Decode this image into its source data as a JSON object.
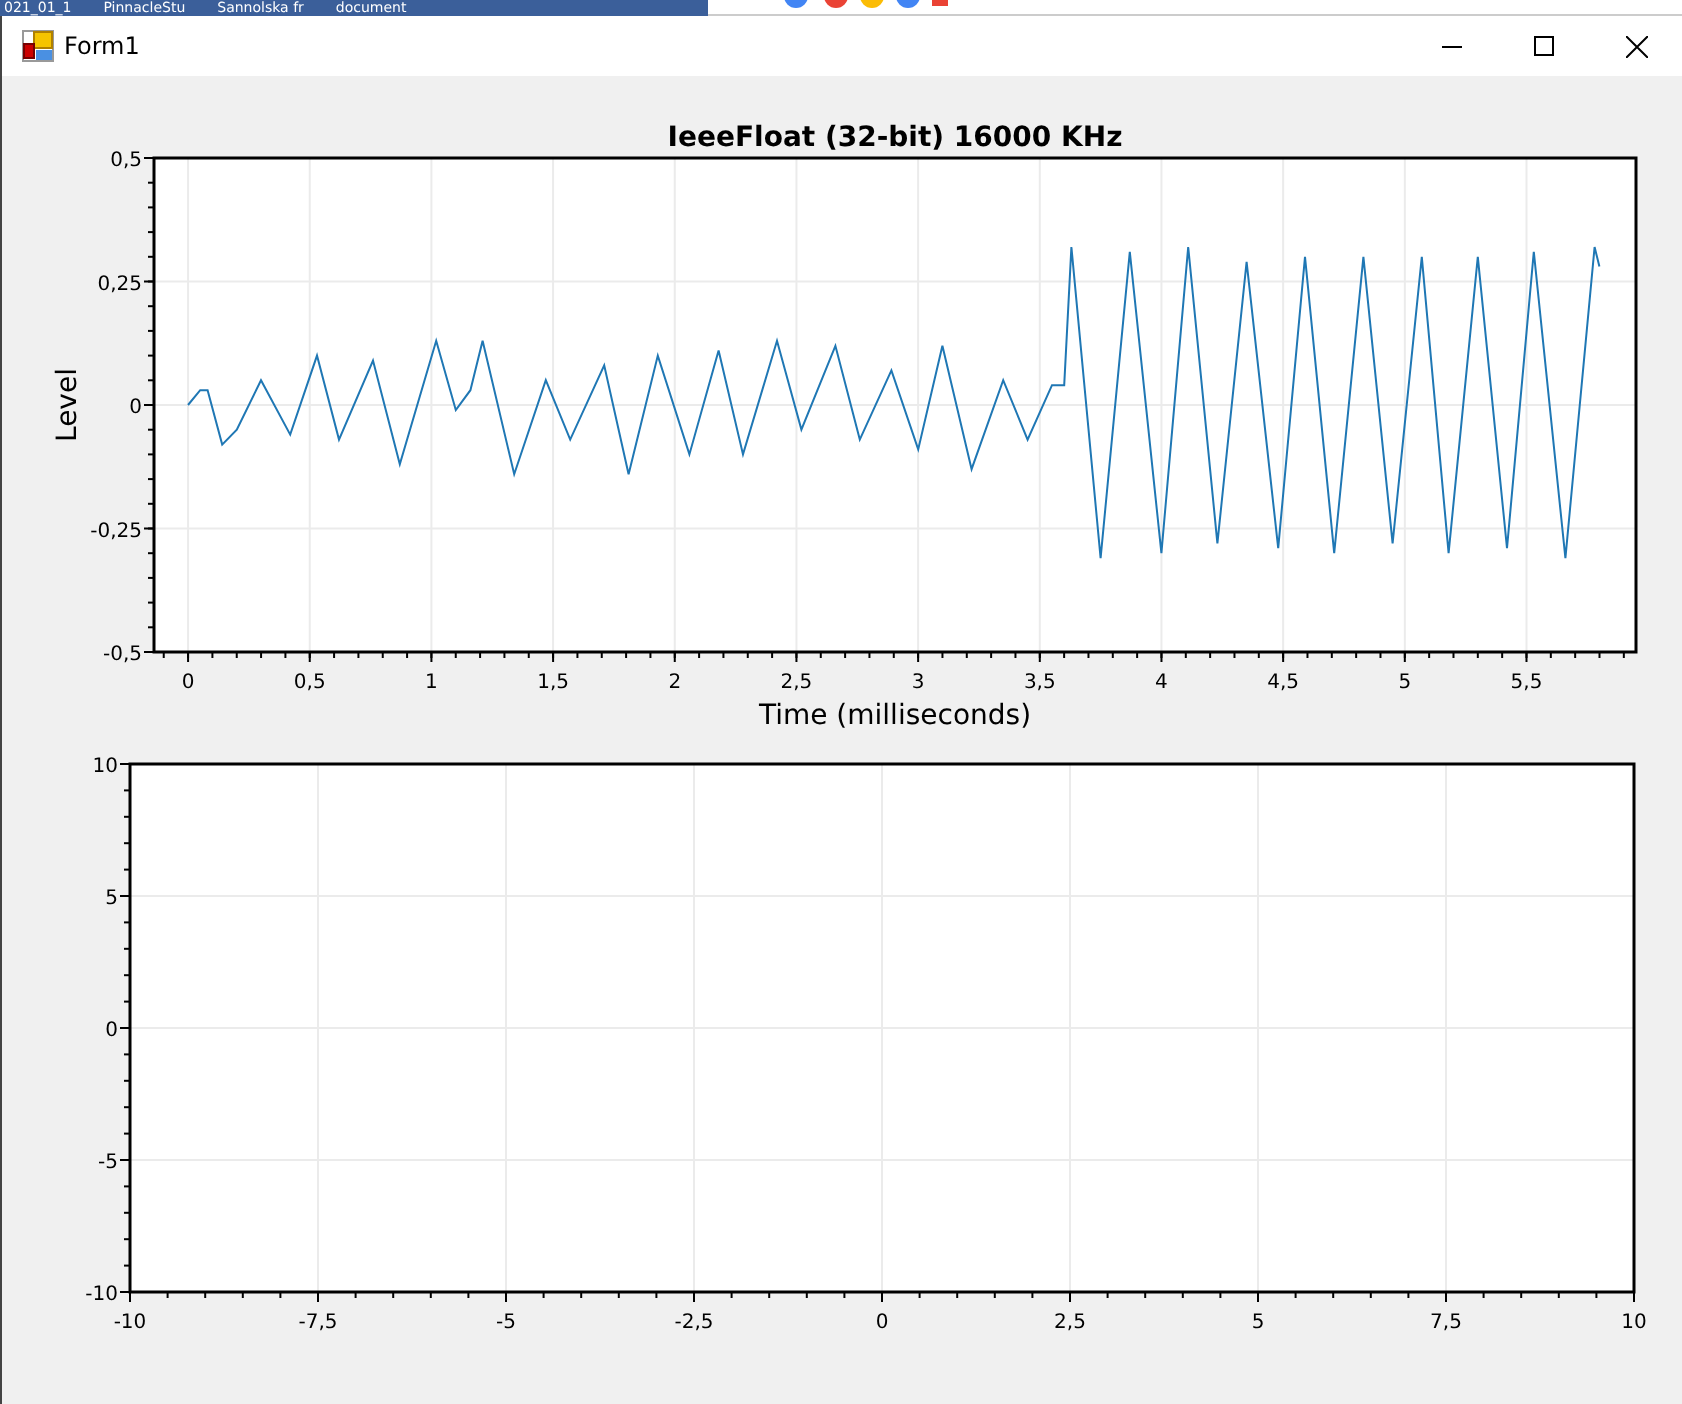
{
  "desktop": {
    "labels": [
      "021_01_1",
      "PinnacleStu",
      "Sannolska fr",
      "document"
    ]
  },
  "window": {
    "title": "Form1"
  },
  "charts": [
    {
      "chart_data": {
        "type": "line",
        "grid": true,
        "title": "IeeeFloat (32-bit) 16000 KHz",
        "xlabel": "Time (milliseconds)",
        "ylabel": "Level",
        "xlim": [
          -0.14,
          5.95
        ],
        "ylim": [
          -0.5,
          0.5
        ],
        "xticks": [
          {
            "value": 0,
            "label": "0"
          },
          {
            "value": 0.5,
            "label": "0,5"
          },
          {
            "value": 1,
            "label": "1"
          },
          {
            "value": 1.5,
            "label": "1,5"
          },
          {
            "value": 2,
            "label": "2"
          },
          {
            "value": 2.5,
            "label": "2,5"
          },
          {
            "value": 3,
            "label": "3"
          },
          {
            "value": 3.5,
            "label": "3,5"
          },
          {
            "value": 4,
            "label": "4"
          },
          {
            "value": 4.5,
            "label": "4,5"
          },
          {
            "value": 5,
            "label": "5"
          },
          {
            "value": 5.5,
            "label": "5,5"
          }
        ],
        "yticks": [
          {
            "value": -0.5,
            "label": "-0,5"
          },
          {
            "value": -0.25,
            "label": "-0,25"
          },
          {
            "value": 0,
            "label": "0"
          },
          {
            "value": 0.25,
            "label": "0,25"
          },
          {
            "value": 0.5,
            "label": "0,5"
          }
        ],
        "x": [
          0,
          0.05,
          0.08,
          0.14,
          0.2,
          0.3,
          0.42,
          0.53,
          0.62,
          0.76,
          0.87,
          1.02,
          1.1,
          1.16,
          1.21,
          1.34,
          1.47,
          1.57,
          1.71,
          1.81,
          1.93,
          2.06,
          2.18,
          2.28,
          2.42,
          2.52,
          2.66,
          2.76,
          2.89,
          3.0,
          3.1,
          3.22,
          3.35,
          3.45,
          3.55,
          3.6,
          3.63,
          3.75,
          3.87,
          4.0,
          4.11,
          4.23,
          4.35,
          4.48,
          4.59,
          4.71,
          4.83,
          4.95,
          5.07,
          5.18,
          5.3,
          5.42,
          5.53,
          5.66,
          5.78,
          5.8
        ],
        "series": [
          {
            "color": "#1f77b4",
            "values": [
              0,
              0.03,
              0.03,
              -0.08,
              -0.05,
              0.05,
              -0.06,
              0.1,
              -0.07,
              0.09,
              -0.12,
              0.13,
              -0.01,
              0.03,
              0.13,
              -0.14,
              0.05,
              -0.07,
              0.08,
              -0.14,
              0.1,
              -0.1,
              0.11,
              -0.1,
              0.13,
              -0.05,
              0.12,
              -0.07,
              0.07,
              -0.09,
              0.12,
              -0.13,
              0.05,
              -0.07,
              0.04,
              0.04,
              0.32,
              -0.31,
              0.31,
              -0.3,
              0.32,
              -0.28,
              0.29,
              -0.29,
              0.3,
              -0.3,
              0.3,
              -0.28,
              0.3,
              -0.3,
              0.3,
              -0.29,
              0.31,
              -0.31,
              0.32,
              0.28
            ]
          }
        ]
      }
    },
    {
      "chart_data": {
        "type": "line",
        "grid": true,
        "xlim": [
          -10,
          10
        ],
        "ylim": [
          -10,
          10
        ],
        "xticks": [
          {
            "value": -10,
            "label": "-10"
          },
          {
            "value": -7.5,
            "label": "-7,5"
          },
          {
            "value": -5,
            "label": "-5"
          },
          {
            "value": -2.5,
            "label": "-2,5"
          },
          {
            "value": 0,
            "label": "0"
          },
          {
            "value": 2.5,
            "label": "2,5"
          },
          {
            "value": 5,
            "label": "5"
          },
          {
            "value": 7.5,
            "label": "7,5"
          },
          {
            "value": 10,
            "label": "10"
          }
        ],
        "yticks": [
          {
            "value": -10,
            "label": "-10"
          },
          {
            "value": -5,
            "label": "-5"
          },
          {
            "value": 0,
            "label": "0"
          },
          {
            "value": 5,
            "label": "5"
          },
          {
            "value": 10,
            "label": "10"
          }
        ]
      }
    }
  ]
}
